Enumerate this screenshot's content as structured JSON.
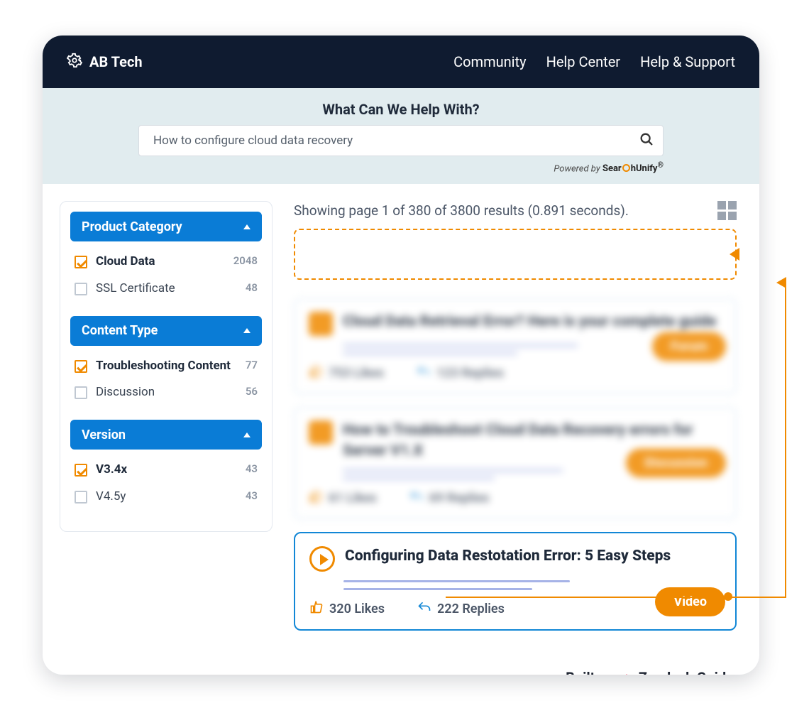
{
  "header": {
    "brand": "AB Tech",
    "nav": {
      "community": "Community",
      "help_center": "Help Center",
      "help_support": "Help & Support"
    }
  },
  "banner": {
    "title": "What Can We Help With?",
    "search_value": "How to configure cloud data recovery",
    "powered_prefix": "Powered by "
  },
  "facets": [
    {
      "title": "Product Category",
      "items": [
        {
          "label": "Cloud Data",
          "count": "2048",
          "checked": true
        },
        {
          "label": "SSL Certificate",
          "count": "48",
          "checked": false
        }
      ]
    },
    {
      "title": "Content Type",
      "items": [
        {
          "label": "Troubleshooting Content",
          "count": "77",
          "checked": true
        },
        {
          "label": "Discussion",
          "count": "56",
          "checked": false
        }
      ]
    },
    {
      "title": "Version",
      "items": [
        {
          "label": "V3.4x",
          "count": "43",
          "checked": true
        },
        {
          "label": "V4.5y",
          "count": "43",
          "checked": false
        }
      ]
    }
  ],
  "results_summary": "Showing page 1 of 380 of 3800 results (0.891 seconds).",
  "results": [
    {
      "title": "Cloud Data Retrieval Error? Here is your complete guide",
      "likes": "753 Likes",
      "replies": "123 Replies",
      "tag": "Forum",
      "blurred": true
    },
    {
      "title": "How to Troubleshoot Cloud Data Recovery errors for Server V1.X",
      "likes": "61 Likes",
      "replies": "69 Replies",
      "tag": "Discussion",
      "blurred": true
    },
    {
      "title": "Configuring Data Restotation Error: 5 Easy Steps",
      "likes": "320 Likes",
      "replies": "222 Replies",
      "tag": "Video",
      "blurred": false
    }
  ],
  "builton": {
    "prefix": "Built on ",
    "product": "Zendesk Guide"
  }
}
